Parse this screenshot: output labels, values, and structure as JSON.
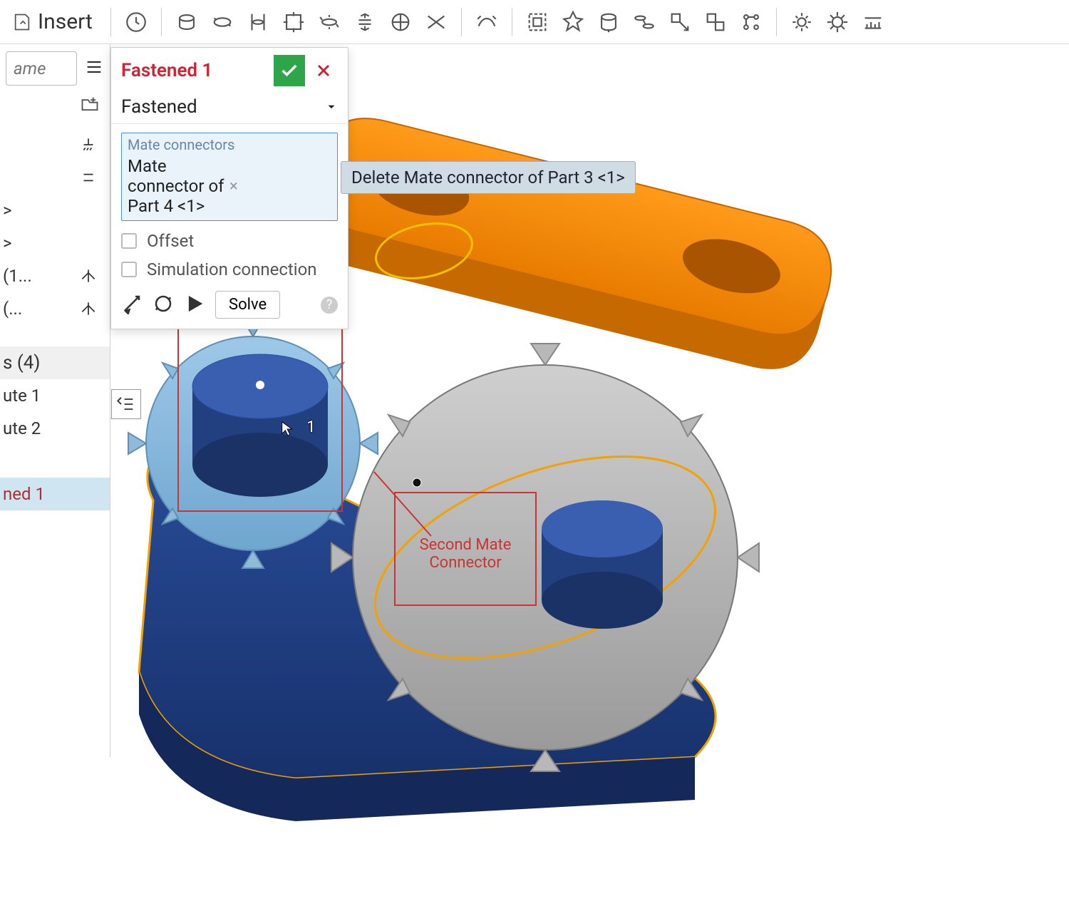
{
  "toolbar": {
    "insert_label": "Insert"
  },
  "sidebar": {
    "search_placeholder": "ame",
    "rows": [
      {
        "label": ""
      },
      {
        "label": ""
      },
      {
        "label": ">"
      },
      {
        "label": ">"
      },
      {
        "label": "(1..."
      },
      {
        "label": "(..."
      }
    ],
    "mates_header": "s (4)",
    "mates": [
      {
        "label": "ute 1"
      },
      {
        "label": "ute 2"
      },
      {
        "label": ""
      },
      {
        "label": "ned 1",
        "selected": true
      }
    ]
  },
  "dialog": {
    "title": "Fastened 1",
    "type": "Fastened",
    "section_label": "Mate connectors",
    "selection": "Mate connector of Part 4 <1>",
    "offset_label": "Offset",
    "sim_label": "Simulation connection",
    "solve_label": "Solve"
  },
  "tooltip": {
    "text": "Delete Mate connector of Part 3 <1>"
  },
  "viewport": {
    "annotation2_text": "Second Mate\nConnector",
    "cursor_label": "1"
  }
}
